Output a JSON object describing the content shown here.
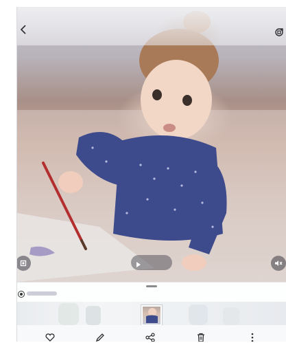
{
  "viewer": {
    "icons": {
      "back": "chevron-left-icon",
      "rotate": "rotate-icon",
      "crop": "crop-icon",
      "play": "play-icon",
      "mute": "volume-mute-icon"
    }
  },
  "info_strip": {
    "icons": {
      "radio": "radio-selected-icon",
      "handle": "drag-handle-icon"
    }
  },
  "toolbar": {
    "items": [
      {
        "icon": "heart-icon"
      },
      {
        "icon": "pencil-icon"
      },
      {
        "icon": "share-icon"
      },
      {
        "icon": "trash-icon"
      },
      {
        "icon": "more-vertical-icon"
      }
    ]
  },
  "colors": {
    "icon": "#2b2b30",
    "overlay_button": "#3c3c46",
    "toolbar_bg": "#f8f9fa"
  }
}
